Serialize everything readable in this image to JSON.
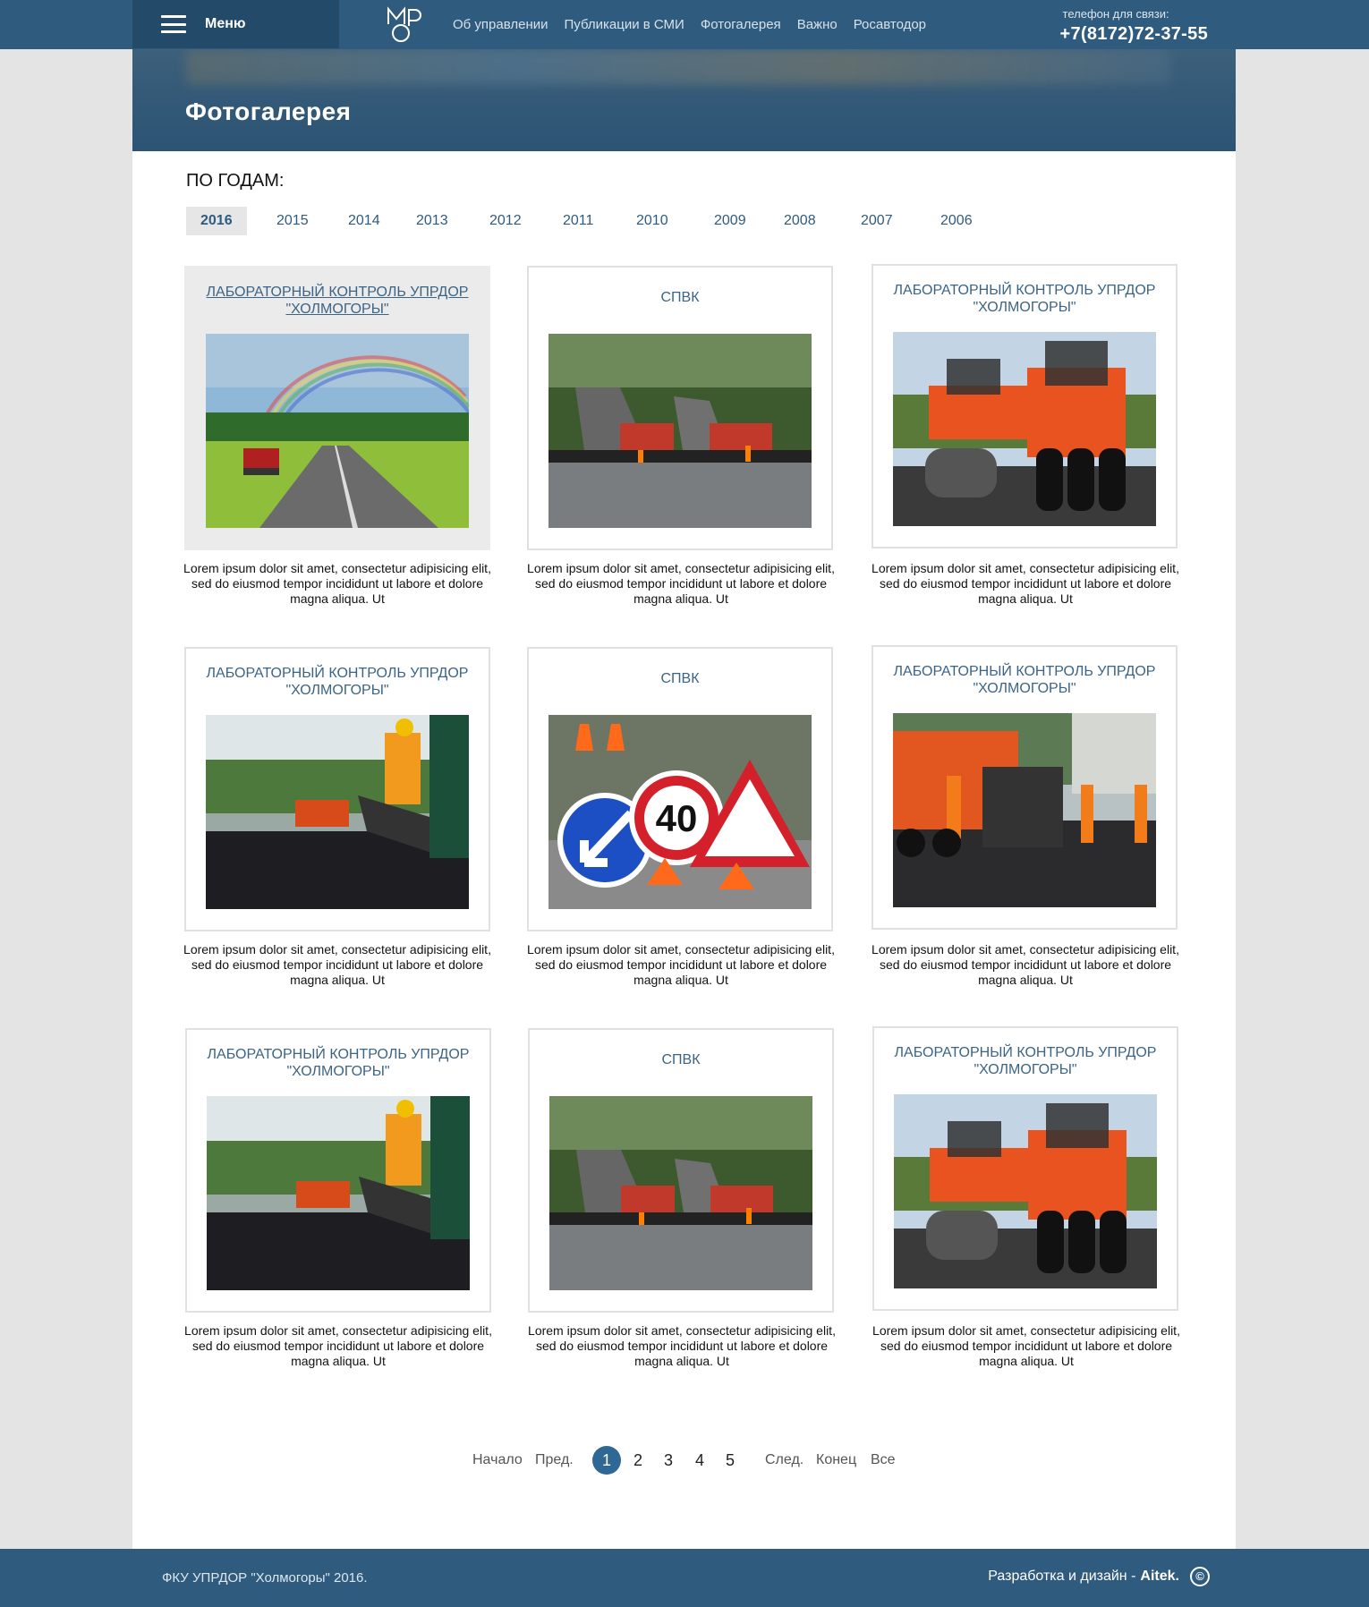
{
  "header": {
    "menu_label": "Меню",
    "nav": [
      "Об управлении",
      "Публикации в СМИ",
      "Фотогалерея",
      "Важно",
      "Росавтодор"
    ],
    "phone_label": "телефон для связи:",
    "phone_number": "+7(8172)72-37-55"
  },
  "page": {
    "title": "Фотогалерея",
    "years_label": "ПО ГОДАМ:",
    "years": [
      "2016",
      "2015",
      "2014",
      "2013",
      "2012",
      "2011",
      "2010",
      "2009",
      "2008",
      "2007",
      "2006"
    ],
    "active_year": "2016"
  },
  "gallery": [
    {
      "title": "Лабораторный контроль Упрдор \"Холмогоры\"",
      "image": "road-rainbow-photo",
      "desc": "Lorem ipsum dolor sit amet, consectetur adipisicing elit, sed do eiusmod tempor incididunt ut labore et dolore magna aliqua. Ut"
    },
    {
      "title": "СПВК",
      "image": "asphalt-pavers-photo",
      "desc": "Lorem ipsum dolor sit amet, consectetur adipisicing elit, sed do eiusmod tempor incididunt ut labore et dolore magna aliqua. Ut"
    },
    {
      "title": "Лабораторный контроль Упрдор \"Холмогоры\"",
      "image": "road-roller-photo",
      "desc": "Lorem ipsum dolor sit amet, consectetur adipisicing elit, sed do eiusmod tempor incididunt ut labore et dolore magna aliqua. Ut"
    },
    {
      "title": "Лабораторный контроль Упрдор \"Холмогоры\"",
      "image": "worker-asphalt-photo",
      "desc": "Lorem ipsum dolor sit amet, consectetur adipisicing elit, sed do eiusmod tempor incididunt ut labore et dolore magna aliqua. Ut"
    },
    {
      "title": "СПВК",
      "image": "road-signs-photo",
      "sign_text": "40",
      "desc": "Lorem ipsum dolor sit amet, consectetur adipisicing elit, sed do eiusmod tempor incididunt ut labore et dolore magna aliqua. Ut"
    },
    {
      "title": "Лабораторный контроль Упрдор \"Холмогоры\"",
      "image": "road-repair-crew-photo",
      "desc": "Lorem ipsum dolor sit amet, consectetur adipisicing elit, sed do eiusmod tempor incididunt ut labore et dolore magna aliqua. Ut"
    },
    {
      "title": "Лабораторный контроль Упрдор \"Холмогоры\"",
      "image": "worker-asphalt-photo",
      "desc": "Lorem ipsum dolor sit amet, consectetur adipisicing elit, sed do eiusmod tempor incididunt ut labore et dolore magna aliqua. Ut"
    },
    {
      "title": "СПВК",
      "image": "asphalt-pavers-photo",
      "desc": "Lorem ipsum dolor sit amet, consectetur adipisicing elit, sed do eiusmod tempor incididunt ut labore et dolore magna aliqua. Ut"
    },
    {
      "title": "Лабораторный контроль Упрдор \"Холмогоры\"",
      "image": "road-roller-photo",
      "desc": "Lorem ipsum dolor sit amet, consectetur adipisicing elit, sed do eiusmod tempor incididunt ut labore et dolore magna aliqua. Ut"
    }
  ],
  "pagination": {
    "first": "Начало",
    "prev": "Пред.",
    "pages": [
      "1",
      "2",
      "3",
      "4",
      "5"
    ],
    "current": "1",
    "next": "След.",
    "last": "Конец",
    "all": "Все"
  },
  "footer": {
    "left": "ФКУ УПРДОР \"Холмогоры\" 2016.",
    "dev_label": "Разработка и дизайн -",
    "dev_name": "Aitek.",
    "copyright_icon": "©"
  },
  "colors": {
    "brand": "#2f5b7e",
    "brand_dark": "#244a69",
    "link": "#3b6486",
    "active_page": "#2f6894"
  }
}
